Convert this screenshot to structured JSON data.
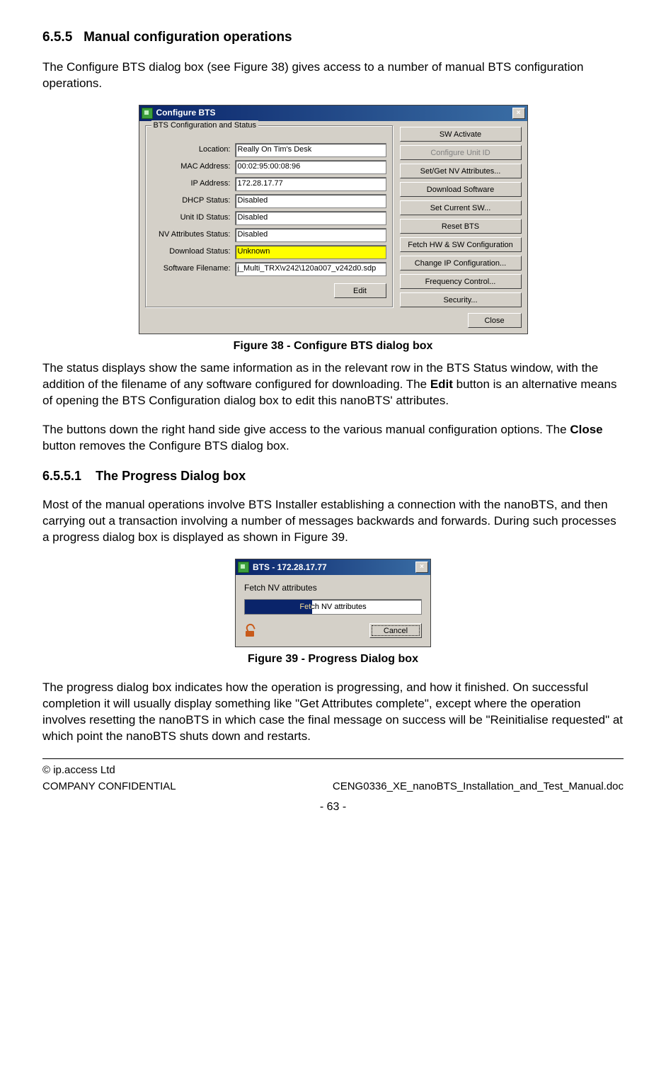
{
  "section": {
    "number": "6.5.5",
    "title": "Manual configuration operations"
  },
  "para1": "The Configure BTS dialog box (see Figure 38) gives access to a number of manual BTS configuration operations.",
  "figure38": {
    "caption": "Figure 38 - Configure BTS dialog box",
    "dialog": {
      "title": "Configure BTS",
      "group_legend": "BTS Configuration and Status",
      "fields": {
        "location_label": "Location:",
        "location_value": "Really On Tim's Desk",
        "mac_label": "MAC Address:",
        "mac_value": "00:02:95:00:08:96",
        "ip_label": "IP Address:",
        "ip_value": "172.28.17.77",
        "dhcp_label": "DHCP Status:",
        "dhcp_value": "Disabled",
        "unitid_label": "Unit ID Status:",
        "unitid_value": "Disabled",
        "nv_label": "NV Attributes Status:",
        "nv_value": "Disabled",
        "dl_label": "Download Status:",
        "dl_value": "Unknown",
        "sw_label": "Software Filename:",
        "sw_value": "j_Multi_TRX\\v242\\120a007_v242d0.sdp"
      },
      "edit_btn": "Edit",
      "buttons": {
        "sw_activate": "SW Activate",
        "configure_unit_id": "Configure Unit ID",
        "setget_nv": "Set/Get NV Attributes...",
        "download_sw": "Download Software",
        "set_current_sw": "Set Current SW...",
        "reset_bts": "Reset BTS",
        "fetch_cfg": "Fetch HW & SW Configuration",
        "change_ip": "Change IP Configuration...",
        "freq_ctrl": "Frequency Control...",
        "security": "Security..."
      },
      "close_btn": "Close"
    }
  },
  "para2_1": "The status displays show the same information as in the relevant row in the BTS Status window, with the addition of the filename of any software configured for downloading. The ",
  "para2_edit": "Edit",
  "para2_2": " button is an alternative means of opening the BTS Configuration dialog box to edit this nanoBTS' attributes.",
  "para3_1": "The buttons down the right hand side give access to the various manual configuration options. The ",
  "para3_close": "Close",
  "para3_2": " button removes the Configure BTS dialog box.",
  "subsection": {
    "number": "6.5.5.1",
    "title": "The Progress Dialog box"
  },
  "para4": "Most of the manual operations involve BTS Installer establishing a connection with the nanoBTS, and then carrying out a transaction involving a number of messages backwards and forwards. During such processes a progress dialog box is displayed as shown in Figure 39.",
  "figure39": {
    "caption": "Figure 39 - Progress Dialog box",
    "dialog": {
      "title": "BTS - 172.28.17.77",
      "label": "Fetch NV attributes",
      "bar_text": "Fetch NV attributes",
      "cancel": "Cancel"
    }
  },
  "para5": "The progress dialog box indicates how the operation is progressing, and how it finished. On successful completion it will usually display something like \"Get Attributes complete\", except where the operation involves resetting the nanoBTS in which case the final message on success will be \"Reinitialise requested\" at which point the nanoBTS shuts down and restarts.",
  "footer": {
    "copyright": "© ip.access Ltd",
    "confidential": "COMPANY CONFIDENTIAL",
    "docname": "CENG0336_XE_nanoBTS_Installation_and_Test_Manual.doc",
    "page": "- 63 -"
  }
}
